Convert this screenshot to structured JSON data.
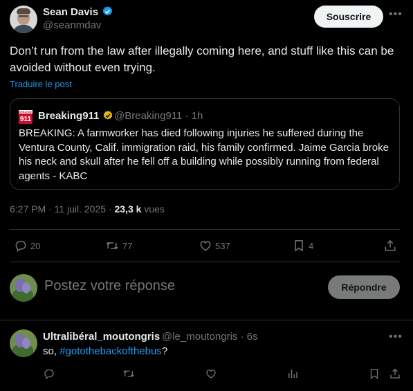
{
  "tweet": {
    "author_name": "Sean Davis",
    "author_handle": "@seanmdav",
    "follow_label": "Souscrire",
    "text": "Don’t run from the law after illegally coming here, and stuff like this can be avoided without even trying.",
    "translate_label": "Traduire le post",
    "quote": {
      "logo_text": "911",
      "logo_top_text": "BREAKING",
      "author_name": "Breaking911",
      "author_handle": "@Breaking911",
      "time": "· 1h",
      "text": "BREAKING: A farmworker has died following injuries he suffered during the Ventura County, Calif. immigration raid, his family confirmed. Jaime Garcia broke his neck and skull after he fell off a building while possibly running from federal agents - KABC"
    },
    "timestamp": "6:27 PM · 11 juil. 2025 ·",
    "views_count": "23,3 k",
    "views_label": "vues",
    "actions": {
      "replies": "20",
      "reposts": "77",
      "likes": "537",
      "bookmarks": "4"
    }
  },
  "composer": {
    "placeholder": "Postez votre réponse",
    "reply_button": "Répondre"
  },
  "reply": {
    "author_name": "Ultralibéral_moutongris",
    "author_handle": "@le_moutongris",
    "time": "· 6s",
    "text_prefix": "so, ",
    "hashtag": "#gotothebackofthebus",
    "text_suffix": "?"
  },
  "colors": {
    "background": "#000000",
    "text": "#e7e9ea",
    "muted": "#71767b",
    "accent": "#1d9bf0",
    "verified_blue": "#1d9bf0",
    "verified_gold": "#e2b719",
    "border": "#2f3336"
  },
  "icons": [
    "verified-badge-icon",
    "more-icon",
    "reply-icon",
    "repost-icon",
    "like-icon",
    "bookmark-icon",
    "share-icon",
    "views-chart-icon"
  ]
}
